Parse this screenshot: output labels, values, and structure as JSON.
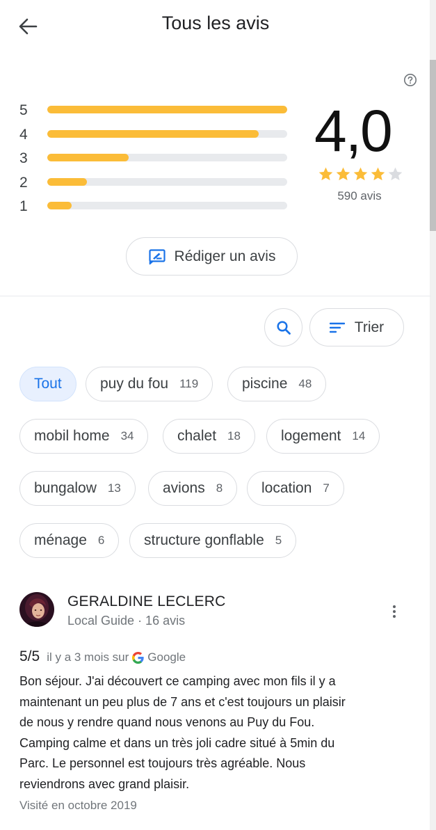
{
  "header": {
    "title": "Tous les avis"
  },
  "summary": {
    "score": "4,0",
    "stars_filled": 4,
    "stars_total": 5,
    "review_count": "590 avis"
  },
  "histogram": [
    {
      "label": "5",
      "fraction": 1.0
    },
    {
      "label": "4",
      "fraction": 0.88
    },
    {
      "label": "3",
      "fraction": 0.34
    },
    {
      "label": "2",
      "fraction": 0.165
    },
    {
      "label": "1",
      "fraction": 0.1
    }
  ],
  "actions": {
    "write_review": "Rédiger un avis",
    "sort": "Trier"
  },
  "chips": [
    {
      "label": "Tout",
      "count": "",
      "active": true
    },
    {
      "label": "puy du fou",
      "count": "119"
    },
    {
      "label": "piscine",
      "count": "48"
    },
    {
      "label": "mobil home",
      "count": "34"
    },
    {
      "label": "chalet",
      "count": "18"
    },
    {
      "label": "logement",
      "count": "14"
    },
    {
      "label": "bungalow",
      "count": "13"
    },
    {
      "label": "avions",
      "count": "8"
    },
    {
      "label": "location",
      "count": "7"
    },
    {
      "label": "ménage",
      "count": "6"
    },
    {
      "label": "structure gonflable",
      "count": "5"
    }
  ],
  "review": {
    "author": "GERALDINE LECLERC",
    "meta": "Local Guide · 16 avis",
    "rating": "5/5",
    "time": "il y a 3 mois sur",
    "source": "Google",
    "lines": [
      "Bon séjour. J'ai découvert ce camping avec mon fils il y a",
      "maintenant un peu plus de 7 ans et c'est toujours un plaisir",
      "de nous y rendre quand nous venons au Puy du Fou.",
      "Camping calme et dans un très joli cadre situé à 5min du",
      "Parc. Le personnel est toujours très agréable. Nous",
      "reviendrons avec grand plaisir."
    ],
    "visited": "Visité en octobre 2019"
  },
  "colors": {
    "star": "#fbbc38",
    "star_empty": "#dadce0",
    "accent": "#1a73e8"
  },
  "icons": [
    "back-arrow-icon",
    "help-icon",
    "edit-review-icon",
    "search-icon",
    "sort-icon",
    "more-vert-icon",
    "google-logo-icon"
  ]
}
